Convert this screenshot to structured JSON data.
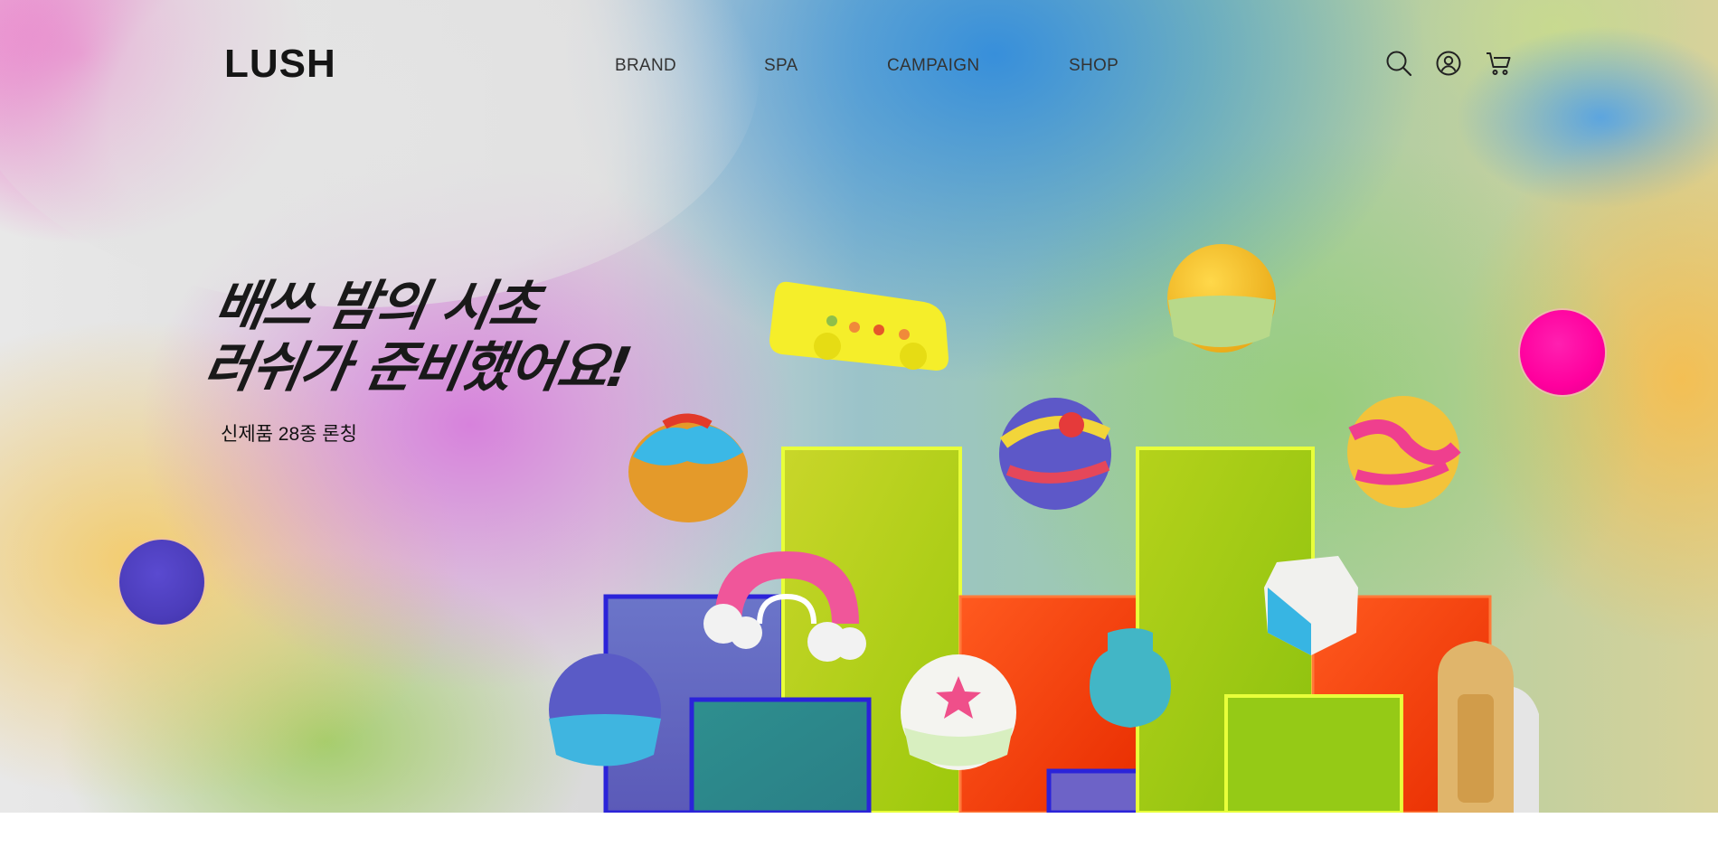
{
  "brand": {
    "logo_text": "LUSH"
  },
  "nav": {
    "items": [
      {
        "label": "BRAND"
      },
      {
        "label": "SPA"
      },
      {
        "label": "CAMPAIGN"
      },
      {
        "label": "SHOP"
      }
    ],
    "icons": [
      "search-icon",
      "account-icon",
      "cart-icon"
    ]
  },
  "hero": {
    "headline_line1": "배쓰 밤의 시초",
    "headline_line2": "러쉬가 준비했어요!",
    "subtext": "신제품 28종 론칭"
  },
  "colors": {
    "accent_pink": "#ff009e",
    "accent_purple": "#4c3dbb",
    "text_dark": "#151515"
  }
}
